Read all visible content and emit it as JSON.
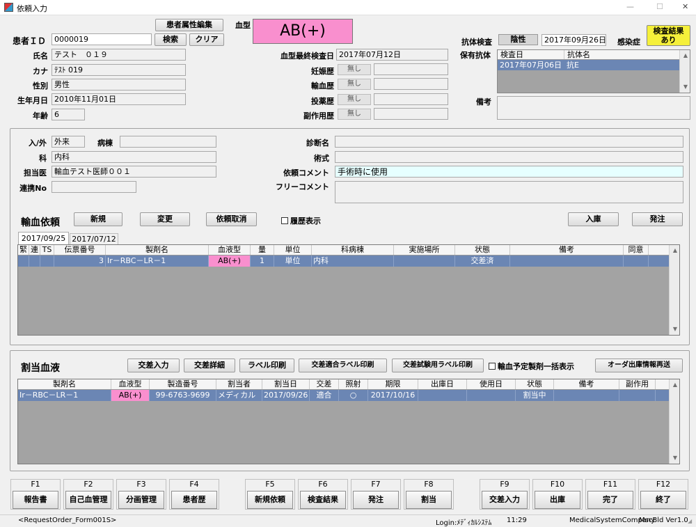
{
  "window": {
    "title": "依頼入力",
    "min": "—",
    "max": "☐",
    "close": "✕"
  },
  "patient": {
    "edit_attr_btn": "患者属性編集",
    "id_label": "患者ＩＤ",
    "id_value": "0000019",
    "search_btn": "検索",
    "clear_btn": "クリア",
    "name_label": "氏名",
    "name_value": "テスト　０１９",
    "kana_label": "カナ",
    "kana_value": "ﾃｽﾄ 019",
    "sex_label": "性別",
    "sex_value": "男性",
    "dob_label": "生年月日",
    "dob_value": "2010年11月01日",
    "age_label": "年齢",
    "age_value": "6"
  },
  "blood": {
    "type_label": "血型",
    "type_value": "AB(+)",
    "last_check_label": "血型最終検査日",
    "last_check_value": "2017年07月12日",
    "pregnancy_label": "妊娠歴",
    "pregnancy_value": "無し",
    "transfusion_label": "輸血歴",
    "transfusion_value": "無し",
    "medication_label": "投薬歴",
    "medication_value": "無し",
    "side_effect_label": "副作用歴",
    "side_effect_value": "無し"
  },
  "antibody": {
    "test_label": "抗体検査",
    "test_result": "陰性",
    "test_date": "2017年09月26日",
    "infection_label": "感染症",
    "infection_btn_line1": "検査結果",
    "infection_btn_line2": "あり",
    "held_label": "保有抗体",
    "col_date": "検査日",
    "col_name": "抗体名",
    "row_date": "2017年07月06日",
    "row_name": "抗E",
    "remarks_label": "備考"
  },
  "order": {
    "inout_label": "入/外",
    "inout_value": "外来",
    "ward_label": "病棟",
    "ward_value": "",
    "dept_label": "科",
    "dept_value": "内科",
    "doctor_label": "担当医",
    "doctor_value": "輸血テスト医師００１",
    "link_label": "連携No",
    "link_value": "",
    "diag_label": "診断名",
    "diag_value": "",
    "surgery_label": "術式",
    "surgery_value": "",
    "req_comment_label": "依頼コメント",
    "req_comment_value": "手術時に使用",
    "free_comment_label": "フリーコメント",
    "free_comment_value": ""
  },
  "request": {
    "title": "輸血依頼",
    "new_btn": "新規",
    "change_btn": "変更",
    "cancel_btn": "依頼取消",
    "history_label": "履歴表示",
    "stock_btn": "入庫",
    "order_btn": "発注",
    "tabs": [
      "2017/09/25",
      "2017/07/12"
    ],
    "columns": [
      "緊",
      "連",
      "TS",
      "伝票番号",
      "製剤名",
      "血液型",
      "量",
      "単位",
      "科病棟",
      "実施場所",
      "状態",
      "備考",
      "同意"
    ],
    "rows": [
      [
        "",
        "",
        "",
        "3",
        "Ir－RBC－LR－1",
        "AB(+)",
        "1",
        "単位",
        "内科",
        "",
        "交差済",
        "",
        ""
      ]
    ]
  },
  "alloc": {
    "title": "割当血液",
    "cross_input_btn": "交差入力",
    "cross_detail_btn": "交差詳細",
    "label_print_btn": "ラベル印刷",
    "cross_label_btn": "交差適合ラベル印刷",
    "test_label_btn": "交差試験用ラベル印刷",
    "bulk_label": "輸血予定製剤一括表示",
    "resend_btn": "オーダ出庫情報再送",
    "columns": [
      "製剤名",
      "血液型",
      "製造番号",
      "割当者",
      "割当日",
      "交差",
      "照射",
      "期限",
      "出庫日",
      "使用日",
      "状態",
      "備考",
      "副作用"
    ],
    "rows": [
      [
        "Ir－RBC－LR－1",
        "AB(+)",
        "99-6763-9699",
        "メディカル",
        "2017/09/26",
        "適合",
        "○",
        "2017/10/16",
        "",
        "",
        "割当中",
        "",
        ""
      ]
    ]
  },
  "fkeys": [
    {
      "key": "F1",
      "label": "報告書"
    },
    {
      "key": "F2",
      "label": "自己血管理"
    },
    {
      "key": "F3",
      "label": "分画管理"
    },
    {
      "key": "F4",
      "label": "患者歴"
    },
    {
      "key": "F5",
      "label": "新規依頼"
    },
    {
      "key": "F6",
      "label": "検査結果"
    },
    {
      "key": "F7",
      "label": "発注"
    },
    {
      "key": "F8",
      "label": "割当"
    },
    {
      "key": "F9",
      "label": "交差入力"
    },
    {
      "key": "F10",
      "label": "出庫"
    },
    {
      "key": "F11",
      "label": "完了"
    },
    {
      "key": "F12",
      "label": "終了"
    }
  ],
  "status": {
    "form": "<RequestOrder_Form001S>",
    "login": "Login:ﾒﾃﾞｨｶﾙｼｽﾃﾑ",
    "time": "11:29",
    "company": "MedicalSystemCompany",
    "version": "MscBld Ver1.0"
  },
  "colors": {
    "blood_type_bg": "#f98fce",
    "selected_row": "#6b86b4",
    "infection_btn": "#f5f03a",
    "comment_bg": "#e6ffff"
  }
}
